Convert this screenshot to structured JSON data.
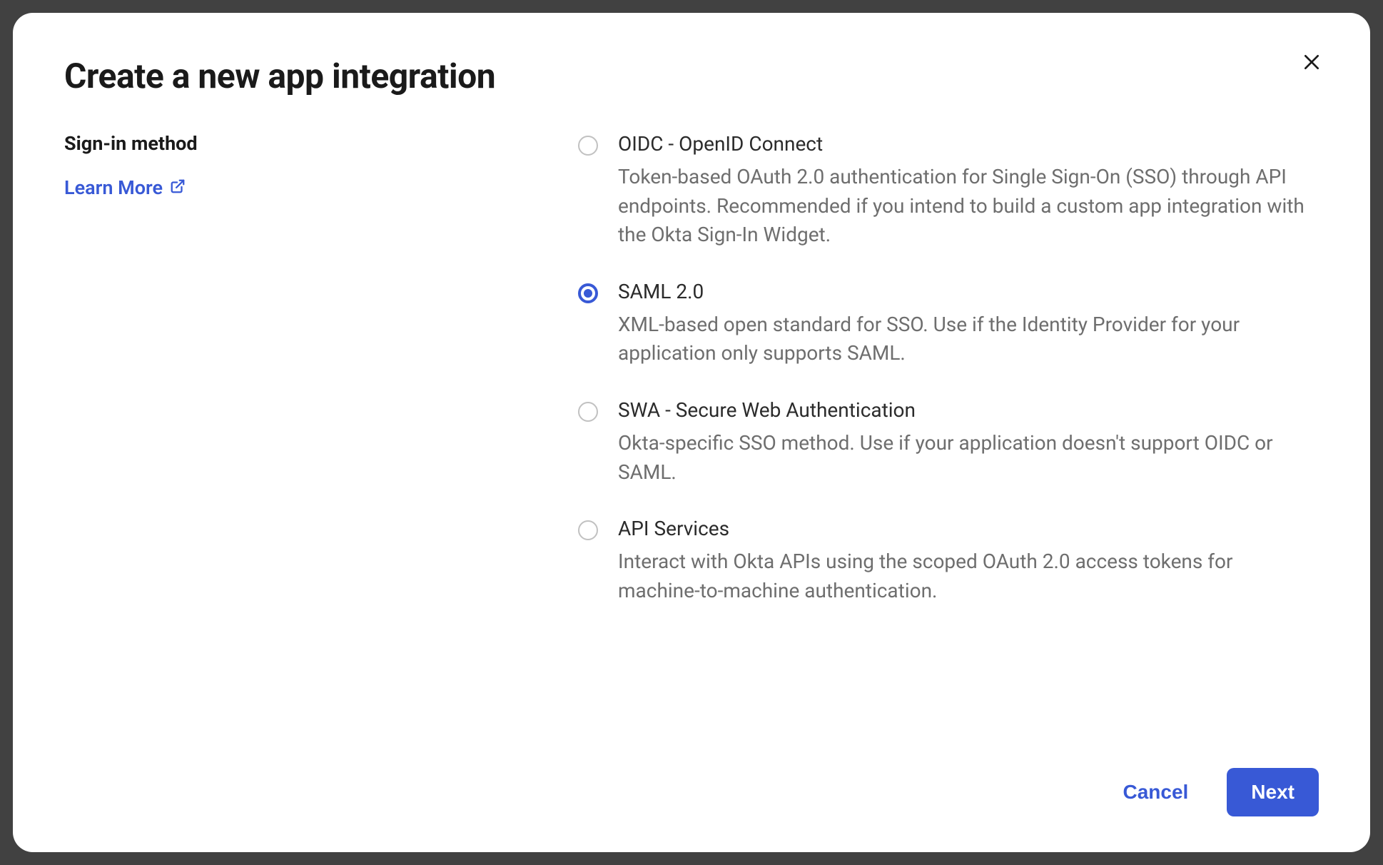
{
  "modal": {
    "title": "Create a new app integration",
    "section_label": "Sign-in method",
    "learn_more": "Learn More"
  },
  "options": [
    {
      "title": "OIDC - OpenID Connect",
      "desc": "Token-based OAuth 2.0 authentication for Single Sign-On (SSO) through API endpoints. Recommended if you intend to build a custom app integration with the Okta Sign-In Widget.",
      "selected": false
    },
    {
      "title": "SAML 2.0",
      "desc": "XML-based open standard for SSO. Use if the Identity Provider for your application only supports SAML.",
      "selected": true
    },
    {
      "title": "SWA - Secure Web Authentication",
      "desc": "Okta-specific SSO method. Use if your application doesn't support OIDC or SAML.",
      "selected": false
    },
    {
      "title": "API Services",
      "desc": "Interact with Okta APIs using the scoped OAuth 2.0 access tokens for machine-to-machine authentication.",
      "selected": false
    }
  ],
  "footer": {
    "cancel": "Cancel",
    "next": "Next"
  }
}
